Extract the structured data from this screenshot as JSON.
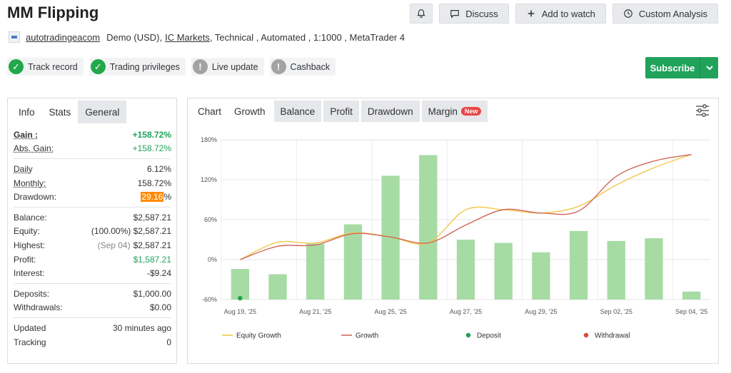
{
  "header": {
    "title": "MM Flipping",
    "buttons": {
      "discuss": "Discuss",
      "watch": "Add to watch",
      "custom": "Custom Analysis"
    },
    "author": "autotradingeacom",
    "meta_prefix": "Demo (USD),",
    "broker": "IC Markets",
    "meta_suffix": ", Technical , Automated , 1:1000 , MetaTrader 4",
    "badges": [
      {
        "label": "Track record",
        "status": "ok"
      },
      {
        "label": "Trading privileges",
        "status": "ok"
      },
      {
        "label": "Live update",
        "status": "warn"
      },
      {
        "label": "Cashback",
        "status": "warn"
      }
    ],
    "subscribe": "Subscribe"
  },
  "stats": {
    "tabs": [
      "Info",
      "Stats",
      "General"
    ],
    "gain_label": "Gain :",
    "gain": "+158.72%",
    "abs_gain_label": "Abs. Gain:",
    "abs_gain": "+158.72%",
    "daily_label": "Daily",
    "daily": "6.12%",
    "monthly_label": "Monthly:",
    "monthly": "158.72%",
    "drawdown_label": "Drawdown:",
    "drawdown_num": "29.16",
    "drawdown_unit": "%",
    "balance_label": "Balance:",
    "balance": "$2,587.21",
    "equity_label": "Equity:",
    "equity": "(100.00%) $2,587.21",
    "highest_label": "Highest:",
    "highest_date": "(Sep 04)",
    "highest": "$2,587.21",
    "profit_label": "Profit:",
    "profit": "$1,587.21",
    "interest_label": "Interest:",
    "interest": "-$9.24",
    "deposits_label": "Deposits:",
    "deposits": "$1,000.00",
    "withdrawals_label": "Withdrawals:",
    "withdrawals": "$0.00",
    "updated_label": "Updated",
    "updated": "30 minutes ago",
    "tracking_label": "Tracking",
    "tracking": "0"
  },
  "chart": {
    "tabs": [
      "Chart",
      "Growth",
      "Balance",
      "Profit",
      "Drawdown",
      "Margin"
    ],
    "new_tag": "New",
    "active_tab": "Growth"
  },
  "chart_data": {
    "type": "bar",
    "ylim": [
      -60,
      180
    ],
    "y_ticks": [
      "180%",
      "120%",
      "60%",
      "0%",
      "-60%"
    ],
    "y_tick_values": [
      180,
      120,
      60,
      0,
      -60
    ],
    "x_tick_labels": [
      "Aug 19, '25",
      "Aug 21, '25",
      "Aug 25, '25",
      "Aug 27, '25",
      "Aug 29, '25",
      "Sep 02, '25",
      "Sep 04, '25"
    ],
    "bars": [
      -14,
      -22,
      24,
      53,
      126,
      157,
      30,
      25,
      11,
      43,
      28,
      32,
      -48
    ],
    "equity_growth": [
      0,
      26,
      25,
      40,
      34,
      25,
      75,
      75,
      70,
      80,
      112,
      138,
      158
    ],
    "growth": [
      0,
      20,
      22,
      39,
      34,
      25,
      52,
      75,
      70,
      73,
      125,
      148,
      158
    ],
    "deposit_point": {
      "index": 0,
      "value": -58
    },
    "legend": [
      {
        "name": "Equity Growth",
        "color": "#f2c84b",
        "kind": "line"
      },
      {
        "name": "Growth",
        "color": "#d0675b",
        "kind": "line"
      },
      {
        "name": "Deposit",
        "color": "#1ea44b",
        "kind": "dot"
      },
      {
        "name": "Withdrawal",
        "color": "#e0473c",
        "kind": "dot"
      }
    ],
    "bar_color": "#a6dba4"
  }
}
